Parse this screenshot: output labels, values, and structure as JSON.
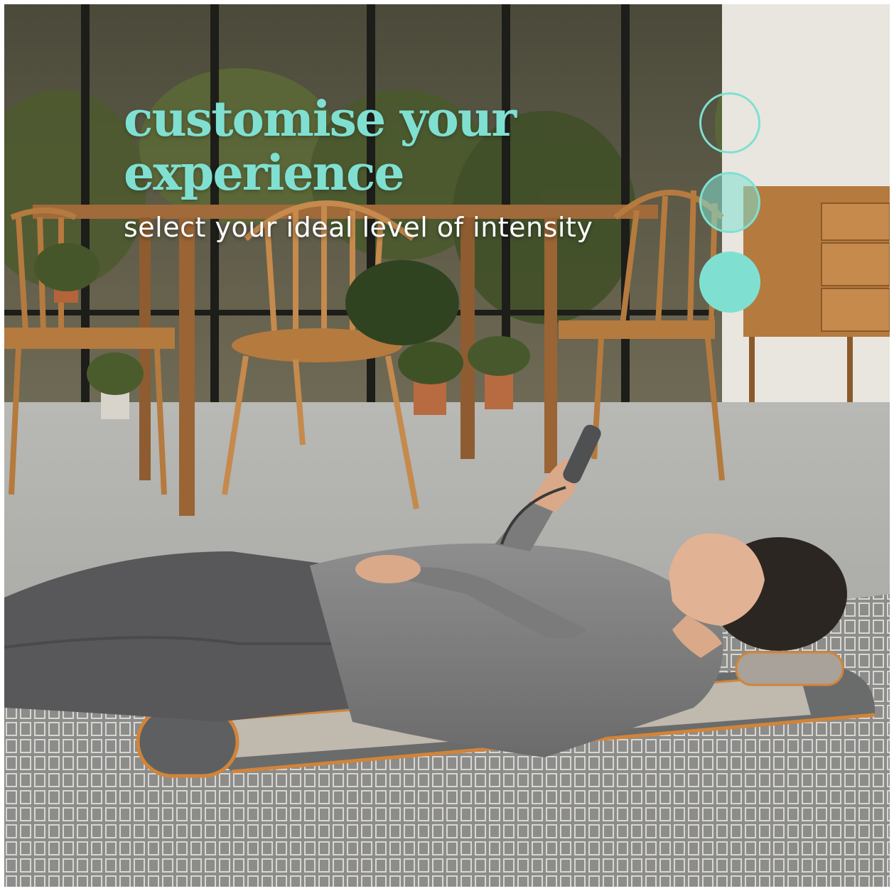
{
  "headline": {
    "line1": "customise your",
    "line2": "experience"
  },
  "subheadline": "select your ideal level of intensity",
  "intensity_levels": {
    "count": 3,
    "states": [
      "outline",
      "half-filled",
      "filled"
    ]
  },
  "colors": {
    "accent": "#7fe0d2",
    "subtext": "#ffffff"
  }
}
